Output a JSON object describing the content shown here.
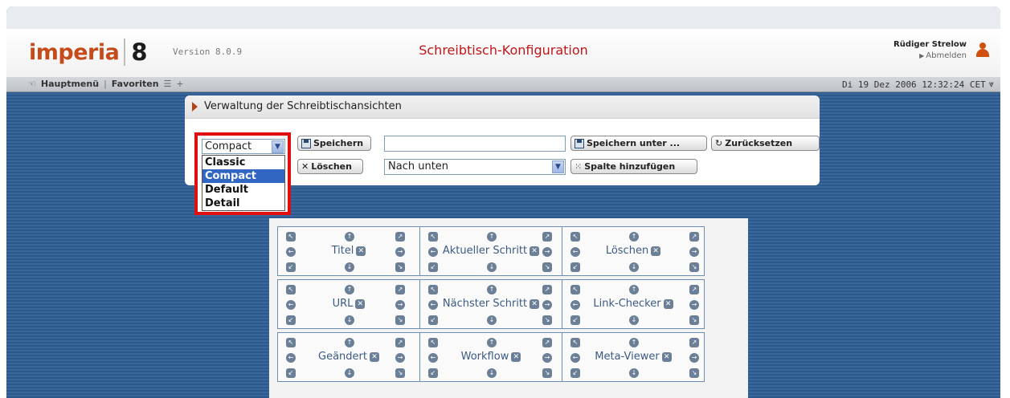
{
  "header": {
    "logo_word": "imperia",
    "logo_number": "8",
    "version": "Version 8.0.9",
    "title": "Schreibtisch-Konfiguration",
    "user_name": "Rüdiger Strelow",
    "logout": "Abmelden"
  },
  "menubar": {
    "main_menu": "Hauptmenü",
    "favorites": "Favoriten",
    "datetime": "Di 19 Dez 2006 12:32:24 CET"
  },
  "panel": {
    "title": "Verwaltung der Schreibtischansichten",
    "save_label": "Speichern",
    "save_as_label": "Speichern unter ...",
    "reset_label": "Zurücksetzen",
    "delete_label": "Löschen",
    "position_value": "Nach unten",
    "add_column_label": "Spalte hinzufügen",
    "name_input_value": ""
  },
  "view_select": {
    "value": "Compact",
    "options": [
      "Classic",
      "Compact",
      "Default",
      "Detail"
    ],
    "selected_index": 1
  },
  "columns": [
    {
      "label": "Titel"
    },
    {
      "label": "Aktueller Schritt"
    },
    {
      "label": "Löschen"
    },
    {
      "label": "URL"
    },
    {
      "label": "Nächster Schritt"
    },
    {
      "label": "Link-Checker"
    },
    {
      "label": "Geändert"
    },
    {
      "label": "Workflow"
    },
    {
      "label": "Meta-Viewer"
    }
  ],
  "colors": {
    "accent": "#c0161a",
    "brand": "#c64b1b",
    "highlight_border": "#e10e10",
    "background": "#2f5e94"
  }
}
